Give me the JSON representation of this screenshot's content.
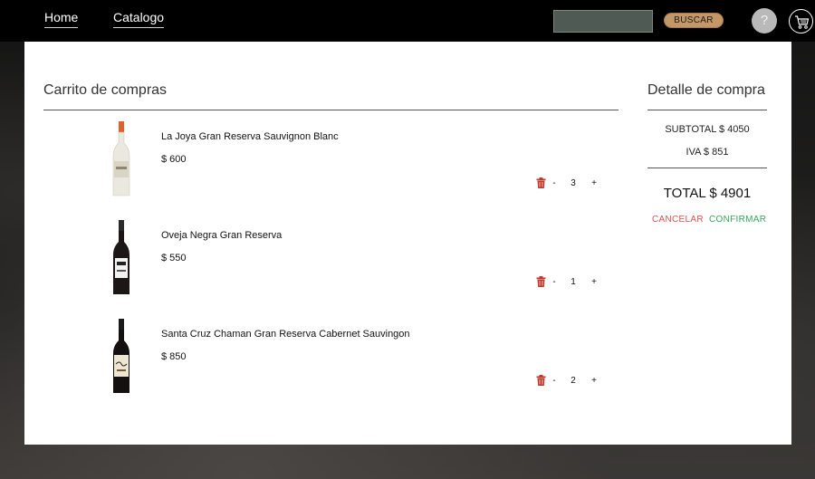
{
  "nav": {
    "home_label": "Home",
    "catalog_label": "Catalogo",
    "search_placeholder": "",
    "search_button": "BUSCAR",
    "help_label": "?"
  },
  "cart": {
    "title": "Carrito de compras",
    "items": [
      {
        "name": "La Joya Gran Reserva Sauvignon Blanc",
        "price": "$ 600",
        "minus": "-",
        "quantity": "3",
        "plus": "+",
        "bottle": "white-wine-bottle"
      },
      {
        "name": "Oveja Negra Gran Reserva",
        "price": "$ 550",
        "minus": "-",
        "quantity": "1",
        "plus": "+",
        "bottle": "red-wine-bottle"
      },
      {
        "name": "Santa Cruz Chaman Gran Reserva Cabernet Sauvingon",
        "price": "$ 850",
        "minus": "-",
        "quantity": "2",
        "plus": "+",
        "bottle": "red-wine-bottle"
      }
    ]
  },
  "detail": {
    "title": "Detalle de compra",
    "subtotal": "SUBTOTAL $ 4050",
    "iva": "IVA $ 851",
    "total": "TOTAL $ 4901",
    "cancel_label": "CANCELAR",
    "confirm_label": "CONFIRMAR"
  },
  "colors": {
    "navbar": "#000000",
    "search_button": "#c49767",
    "trash": "#c0392b",
    "cancel": "#d9534f",
    "confirm": "#3aa45b"
  }
}
